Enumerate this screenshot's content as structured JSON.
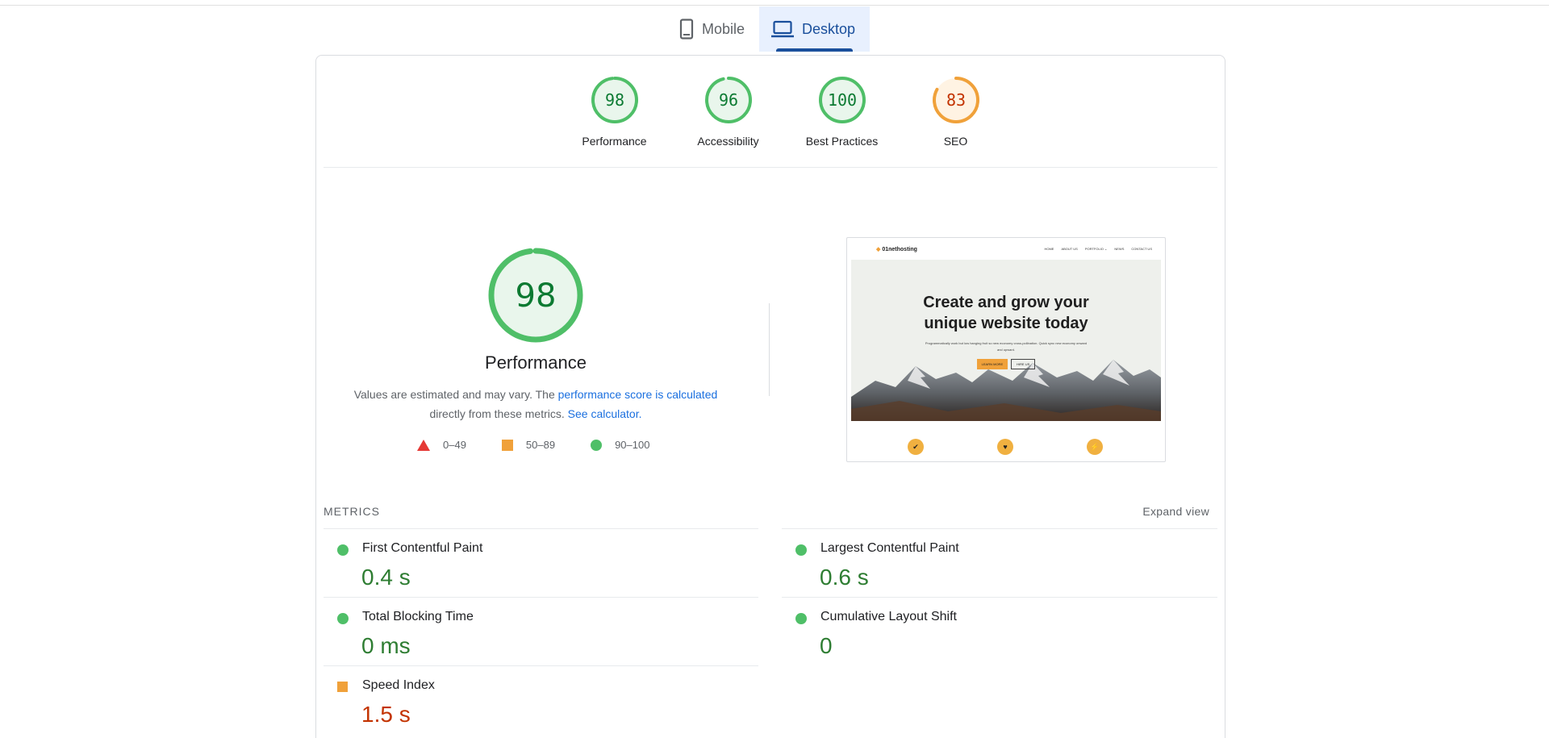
{
  "tabs": [
    {
      "label": "Mobile",
      "icon": "phone-icon",
      "active": false
    },
    {
      "label": "Desktop",
      "icon": "laptop-icon",
      "active": true
    }
  ],
  "gauges": [
    {
      "value": 98,
      "label": "Performance",
      "color": "#0c9d3e"
    },
    {
      "value": 96,
      "label": "Accessibility",
      "color": "#0c9d3e"
    },
    {
      "value": 100,
      "label": "Best Practices",
      "color": "#0c9d3e"
    },
    {
      "value": 83,
      "label": "SEO",
      "color": "#c33300"
    }
  ],
  "performance": {
    "score": 98,
    "title": "Performance",
    "desc_text": "Values are estimated and may vary. The ",
    "desc_link1": "performance score is calculated",
    "desc_text2": "directly from these metrics. ",
    "desc_link2": "See calculator."
  },
  "legend": [
    {
      "range": "0–49",
      "shape": "triangle",
      "color": "#e53935"
    },
    {
      "range": "50–89",
      "shape": "square",
      "color": "#f0a13a"
    },
    {
      "range": "90–100",
      "shape": "circle",
      "color": "#4fbf68"
    }
  ],
  "thumbnail": {
    "logo": "01nethosting",
    "nav_links": [
      "HOME",
      "ABOUT US",
      "PORTFOLIO ⌄",
      "NEWS",
      "CONTACT US"
    ],
    "headline_1": "Create and grow your",
    "headline_2": "unique website today",
    "subtext": "Programmatically work but low hanging fruit so new economy cross-pollination. Quick sync new economy onward and upward.",
    "button_primary": "LEARN MORE",
    "button_secondary": "HIRE US",
    "feature_icons": [
      "✔",
      "♥",
      "⚡"
    ]
  },
  "metrics": {
    "heading": "METRICS",
    "expand_label": "Expand view",
    "items": [
      {
        "label": "First Contentful Paint",
        "value": "0.4 s",
        "status": "good"
      },
      {
        "label": "Largest Contentful Paint",
        "value": "0.6 s",
        "status": "good"
      },
      {
        "label": "Total Blocking Time",
        "value": "0 ms",
        "status": "good"
      },
      {
        "label": "Cumulative Layout Shift",
        "value": "0",
        "status": "good"
      },
      {
        "label": "Speed Index",
        "value": "1.5 s",
        "status": "average"
      }
    ]
  },
  "colors": {
    "good": "#4fbf68",
    "good_fill": "#e9f6ec",
    "average": "#f0a13a",
    "average_fill": "#fff3e3",
    "accent": "#1a4f9c"
  }
}
